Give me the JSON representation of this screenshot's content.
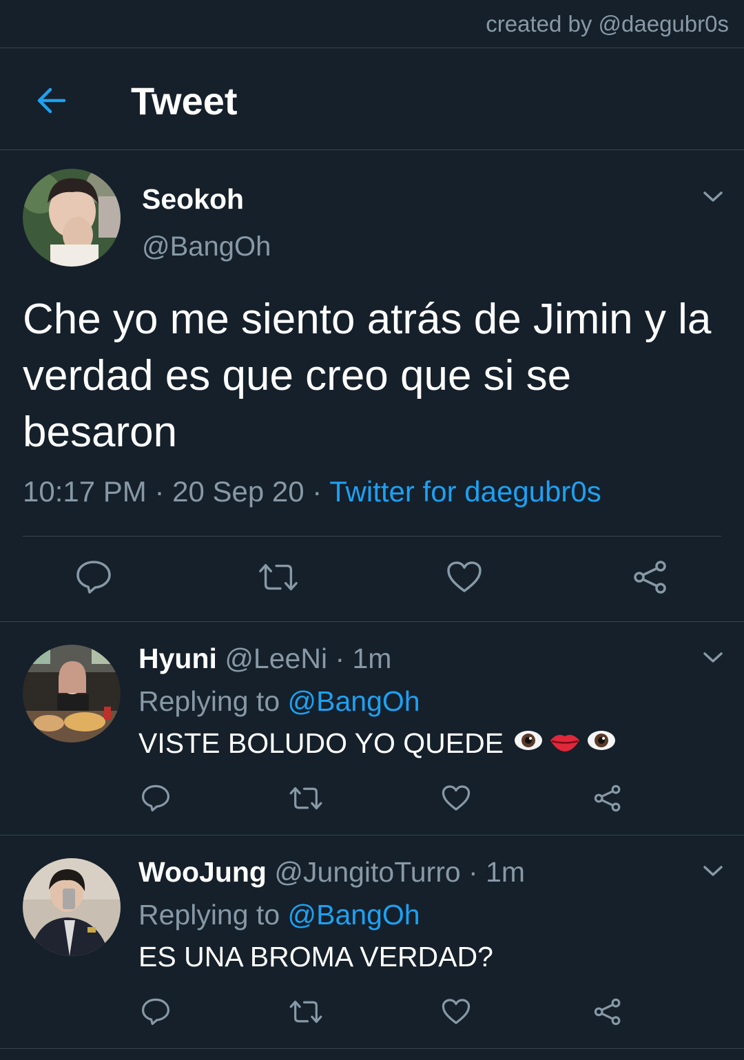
{
  "credit": "created by @daegubr0s",
  "header": {
    "title": "Tweet",
    "back_icon": "arrow-left-icon"
  },
  "colors": {
    "background": "#15202b",
    "accent": "#1da1f2",
    "muted": "#8899a6",
    "divider": "#38444d"
  },
  "main_tweet": {
    "name": "Seokoh",
    "handle": "@BangOh",
    "text": "Che yo me siento atrás de Jimin y la verdad es que creo que si se besaron",
    "time": "10:17 PM",
    "sep1": " · ",
    "date": "20 Sep 20",
    "sep2": " · ",
    "source": "Twitter for daegubr0s"
  },
  "replies": [
    {
      "name": "Hyuni",
      "handle": "@LeeNi",
      "dot": " · ",
      "time": "1m",
      "replying_prefix": "Replying to ",
      "replying_to": "@BangOh",
      "text": "VISTE BOLUDO YO QUEDE",
      "emojis": [
        "eye",
        "lips",
        "eye"
      ]
    },
    {
      "name": "WooJung",
      "handle": "@JungitoTurro",
      "dot": " · ",
      "time": "1m",
      "replying_prefix": "Replying to ",
      "replying_to": "@BangOh",
      "text": "ES UNA BROMA VERDAD?",
      "emojis": []
    }
  ]
}
